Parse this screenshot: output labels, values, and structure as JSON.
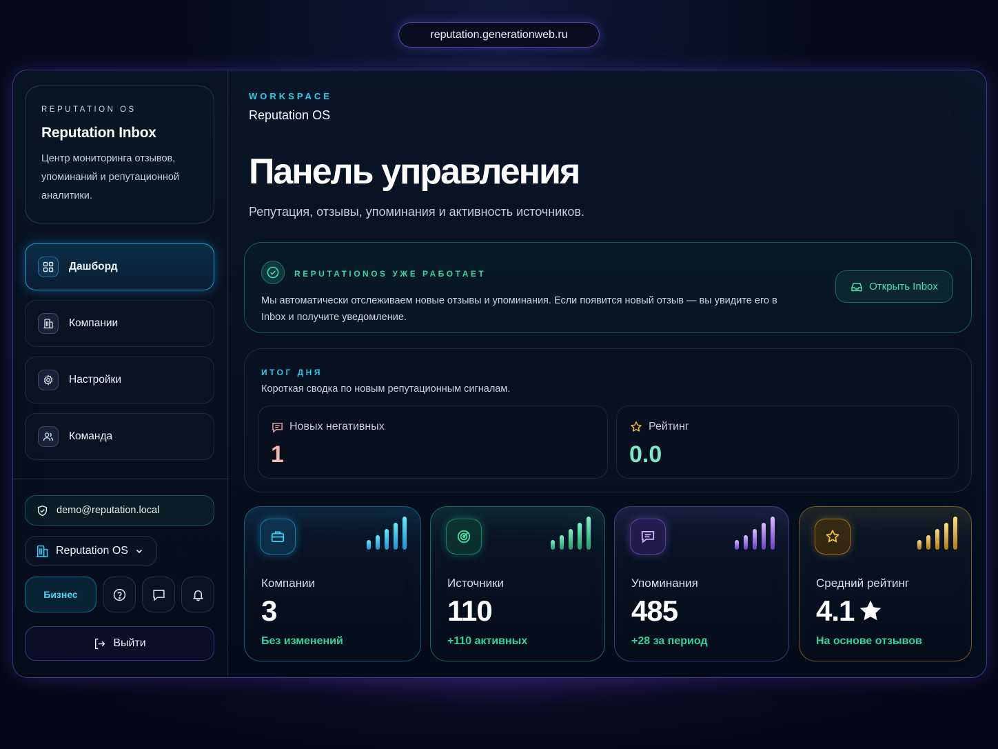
{
  "browser": {
    "url": "reputation.generationweb.ru"
  },
  "sidebar": {
    "brand_eyebrow": "REPUTATION OS",
    "brand_title": "Reputation Inbox",
    "brand_description": "Центр мониторинга отзывов, упоминаний и репутационной аналитики.",
    "nav": [
      {
        "label": "Дашборд",
        "icon": "grid-icon",
        "active": true
      },
      {
        "label": "Компании",
        "icon": "building-icon",
        "active": false
      },
      {
        "label": "Настройки",
        "icon": "gear-icon",
        "active": false
      },
      {
        "label": "Команда",
        "icon": "users-icon",
        "active": false
      }
    ],
    "user_email": "demo@reputation.local",
    "workspace_select": "Reputation OS",
    "plan_label": "Бизнес",
    "logout_label": "Выйти"
  },
  "header": {
    "workspace_eyebrow": "WORKSPACE",
    "workspace_name": "Reputation OS",
    "title": "Панель управления",
    "subtitle": "Репутация, отзывы, упоминания и активность источников."
  },
  "status": {
    "eyebrow": "REPUTATIONOS УЖЕ РАБОТАЕТ",
    "text": "Мы автоматически отслеживаем новые отзывы и упоминания. Если появится новый отзыв — вы увидите его в Inbox и получите уведомление.",
    "button_label": "Открыть Inbox"
  },
  "summary": {
    "eyebrow": "ИТОГ ДНЯ",
    "description": "Короткая сводка по новым репутационным сигналам.",
    "negative_label": "Новых негативных",
    "negative_value": "1",
    "rating_label": "Рейтинг",
    "rating_value": "0.0"
  },
  "kpis": [
    {
      "label": "Компании",
      "value": "3",
      "delta": "Без изменений",
      "icon": "briefcase-icon",
      "accent": "#22b8e6"
    },
    {
      "label": "Источники",
      "value": "110",
      "delta": "+110 активных",
      "icon": "radar-icon",
      "accent": "#2fd49a"
    },
    {
      "label": "Упоминания",
      "value": "485",
      "delta": "+28 за период",
      "icon": "message-icon",
      "accent": "#9a6cf0"
    },
    {
      "label": "Средний рейтинг",
      "value": "4.1",
      "delta": "На основе отзывов",
      "icon": "star-icon",
      "accent": "#e8b426"
    }
  ],
  "colors": {
    "cyan": "#2ad0e8",
    "green": "#33d6a2",
    "purple": "#9a6cf0",
    "gold": "#e8b426",
    "negative_value": "#f2b8a8",
    "rating_value": "#7ee8c8"
  }
}
